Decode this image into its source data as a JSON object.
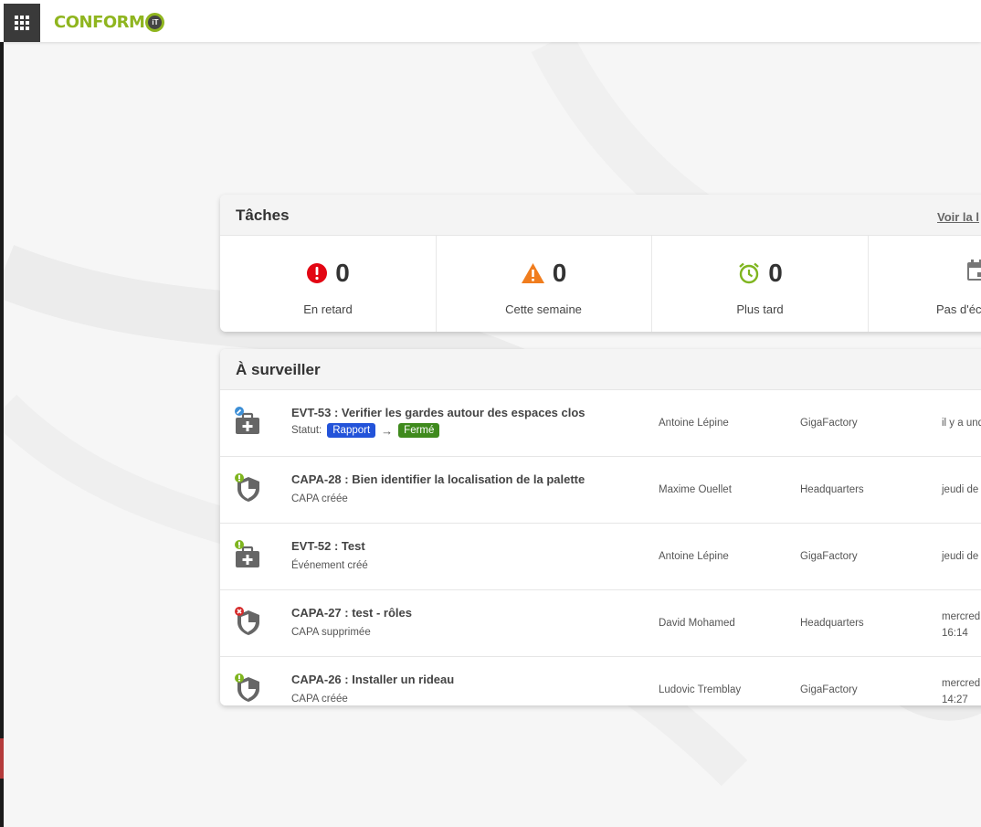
{
  "header": {
    "logo_text": "CONFORM",
    "logo_badge": "iT"
  },
  "tasks": {
    "title": "Tâches",
    "view_all_link": "Voir la l",
    "stats": [
      {
        "icon": "alert-circle-icon",
        "value": "0",
        "label": "En retard",
        "color": "#e30613"
      },
      {
        "icon": "warning-triangle-icon",
        "value": "0",
        "label": "Cette semaine",
        "color": "#f07d1e"
      },
      {
        "icon": "alarm-clock-icon",
        "value": "0",
        "label": "Plus tard",
        "color": "#7fb51f"
      },
      {
        "icon": "calendar-icon",
        "value": "",
        "label": "Pas d'éc",
        "color": "#777777"
      }
    ]
  },
  "watch": {
    "title": "À surveiller",
    "rows": [
      {
        "icon": "event-kit-icon",
        "badge": "edit",
        "title": "EVT-53 : Verifier les gardes autour des espaces clos",
        "status_label": "Statut:",
        "status_from": "Rapport",
        "status_to": "Fermé",
        "user": "Antoine Lépine",
        "site": "GigaFactory",
        "date": "il y a und"
      },
      {
        "icon": "shield-icon",
        "badge": "new",
        "title": "CAPA-28 : Bien identifier la localisation de la palette",
        "subtitle": "CAPA créée",
        "user": "Maxime Ouellet",
        "site": "Headquarters",
        "date": "jeudi de"
      },
      {
        "icon": "event-kit-icon",
        "badge": "new",
        "title": "EVT-52 : Test",
        "subtitle": "Événement créé",
        "user": "Antoine Lépine",
        "site": "GigaFactory",
        "date": "jeudi de"
      },
      {
        "icon": "shield-icon",
        "badge": "deleted",
        "title": "CAPA-27 : test - rôles",
        "subtitle": "CAPA supprimée",
        "user": "David Mohamed",
        "site": "Headquarters",
        "date_line1": "mercred",
        "date_line2": "16:14"
      },
      {
        "icon": "shield-icon",
        "badge": "new",
        "title": "CAPA-26 : Installer un rideau",
        "subtitle": "CAPA créée",
        "user": "Ludovic Tremblay",
        "site": "GigaFactory",
        "date_line1": "mercred",
        "date_line2": "14:27"
      }
    ]
  }
}
